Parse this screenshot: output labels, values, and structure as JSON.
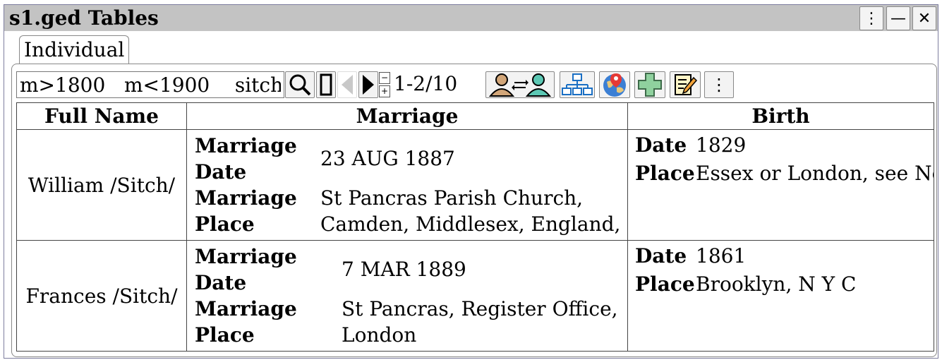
{
  "window": {
    "title": "s1.ged Tables"
  },
  "tabs": [
    {
      "label": "Individual"
    }
  ],
  "toolbar": {
    "search_value": "m>1800   m<1900    sitch",
    "pager_label": "1-2/10",
    "step_minus": "−",
    "step_plus": "+"
  },
  "table": {
    "headers": {
      "name": "Full Name",
      "marriage": "Marriage",
      "birth": "Birth"
    },
    "labels": {
      "marriage_date": [
        "Marriage",
        "Date"
      ],
      "marriage_place": [
        "Marriage",
        "Place"
      ],
      "date": "Date",
      "place": "Place"
    },
    "rows": [
      {
        "name": "William /Sitch/",
        "marriage_date": "23 AUG 1887",
        "marriage_place": [
          "St Pancras Parish Church,",
          "Camden, Middlesex, England,"
        ],
        "birth_date": "1829",
        "birth_place": "Essex or London, see Note"
      },
      {
        "name": "Frances /Sitch/",
        "marriage_date": "7 MAR 1889",
        "marriage_place": [
          "St Pancras, Register Office,",
          "London"
        ],
        "birth_date": "1861",
        "birth_place": "Brooklyn, N Y C"
      }
    ]
  }
}
